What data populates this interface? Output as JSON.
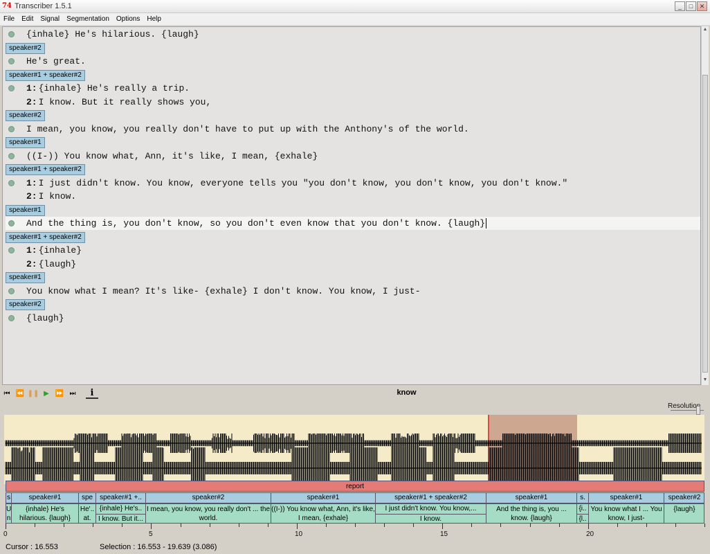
{
  "window": {
    "title": "Transcriber 1.5.1",
    "icon": "74",
    "minimize_glyph": "_",
    "maximize_glyph": "□",
    "close_glyph": "✕"
  },
  "menu": [
    "File",
    "Edit",
    "Signal",
    "Segmentation",
    "Options",
    "Help"
  ],
  "transcript": [
    {
      "kind": "line",
      "text": "{inhale} He's hilarious. {laugh}",
      "dot": true
    },
    {
      "kind": "turn",
      "label": "speaker#2"
    },
    {
      "kind": "line",
      "text": "He's great.",
      "dot": true
    },
    {
      "kind": "turn",
      "label": "speaker#1 + speaker#2"
    },
    {
      "kind": "line",
      "spk": "1:",
      "text": "{inhale} He's really a trip.",
      "dot": true
    },
    {
      "kind": "line",
      "spk": "2:",
      "text": "I know. But it really shows you,",
      "dot": false
    },
    {
      "kind": "turn",
      "label": "speaker#2"
    },
    {
      "kind": "line",
      "text": "I mean, you know, you really don't have to put up with the Anthony's of the world.",
      "dot": true
    },
    {
      "kind": "turn",
      "label": "speaker#1"
    },
    {
      "kind": "line",
      "text": "((I-)) You know what, Ann, it's like, I mean, {exhale}",
      "dot": true
    },
    {
      "kind": "turn",
      "label": "speaker#1 + speaker#2"
    },
    {
      "kind": "line",
      "spk": "1:",
      "text": "I just didn't know. You know, everyone tells you \"you don't know, you don't know, you don't know.\"",
      "dot": true
    },
    {
      "kind": "line",
      "spk": "2:",
      "text": "I know.",
      "dot": false
    },
    {
      "kind": "turn",
      "label": "speaker#1"
    },
    {
      "kind": "line",
      "text": "And the thing is, you don't know, so you don't even know that you don't know. {laugh}",
      "dot": true,
      "highlight": true
    },
    {
      "kind": "turn",
      "label": "speaker#1 + speaker#2"
    },
    {
      "kind": "line",
      "spk": "1:",
      "text": "{inhale}",
      "dot": true
    },
    {
      "kind": "line",
      "spk": "2:",
      "text": "{laugh}",
      "dot": false
    },
    {
      "kind": "turn",
      "label": "speaker#1"
    },
    {
      "kind": "line",
      "text": "You know what I mean? It's like- {exhale} I don't know. You know, I just-",
      "dot": true
    },
    {
      "kind": "turn",
      "label": "speaker#2"
    },
    {
      "kind": "line",
      "text": "{laugh}",
      "dot": true
    }
  ],
  "toolbar": {
    "buttons": [
      {
        "name": "goto-start-icon",
        "glyph": "⏮"
      },
      {
        "name": "rewind-icon",
        "glyph": "⏪"
      },
      {
        "name": "pause-icon",
        "glyph": "❚❚"
      },
      {
        "name": "play-icon",
        "glyph": "▶"
      },
      {
        "name": "forward-icon",
        "glyph": "⏩"
      },
      {
        "name": "goto-end-icon",
        "glyph": "⏭"
      }
    ],
    "info_glyph": "i",
    "current_word": "know"
  },
  "signal": {
    "resolution_label": "Resolution",
    "section_label": "report",
    "duration": 24.0,
    "selection_start": 16.553,
    "selection_end": 19.639,
    "turns": [
      {
        "start": 0.0,
        "end": 0.2,
        "speaker": "s",
        "text": [
          "U",
          "n"
        ]
      },
      {
        "start": 0.2,
        "end": 2.5,
        "speaker": "speaker#1",
        "text": [
          "{inhale} He's hilarious. {laugh}"
        ]
      },
      {
        "start": 2.5,
        "end": 3.1,
        "speaker": "spe",
        "text": [
          "He'.. at."
        ]
      },
      {
        "start": 3.1,
        "end": 4.8,
        "speaker": "speaker#1 +..",
        "text": [
          "{inhale} He's..",
          "I know. But it..."
        ],
        "split": true
      },
      {
        "start": 4.8,
        "end": 9.1,
        "speaker": "speaker#2",
        "text": [
          "I mean, you know, you really don't ... the world."
        ]
      },
      {
        "start": 9.1,
        "end": 12.7,
        "speaker": "speaker#1",
        "text": [
          "((I-)) You know what, Ann, it's like, I mean, {exhale}"
        ]
      },
      {
        "start": 12.7,
        "end": 16.5,
        "speaker": "speaker#1 + speaker#2",
        "text": [
          "I just didn't know. You know,...",
          "I know."
        ],
        "split": true
      },
      {
        "start": 16.5,
        "end": 19.6,
        "speaker": "speaker#1",
        "text": [
          "And the thing is, you ... know. {laugh}"
        ]
      },
      {
        "start": 19.6,
        "end": 20.0,
        "speaker": "s.",
        "text": [
          "{i..",
          "{l.."
        ],
        "split": true
      },
      {
        "start": 20.0,
        "end": 22.6,
        "speaker": "speaker#1",
        "text": [
          "You know what I ... You know, I just-"
        ]
      },
      {
        "start": 22.6,
        "end": 24.0,
        "speaker": "speaker#2",
        "text": [
          "{laugh}"
        ]
      }
    ],
    "ticks": [
      0,
      5,
      10,
      15,
      20
    ]
  },
  "status": {
    "cursor": "Cursor : 16.553",
    "selection": "Selection : 16.553 - 19.639 (3.086)"
  }
}
